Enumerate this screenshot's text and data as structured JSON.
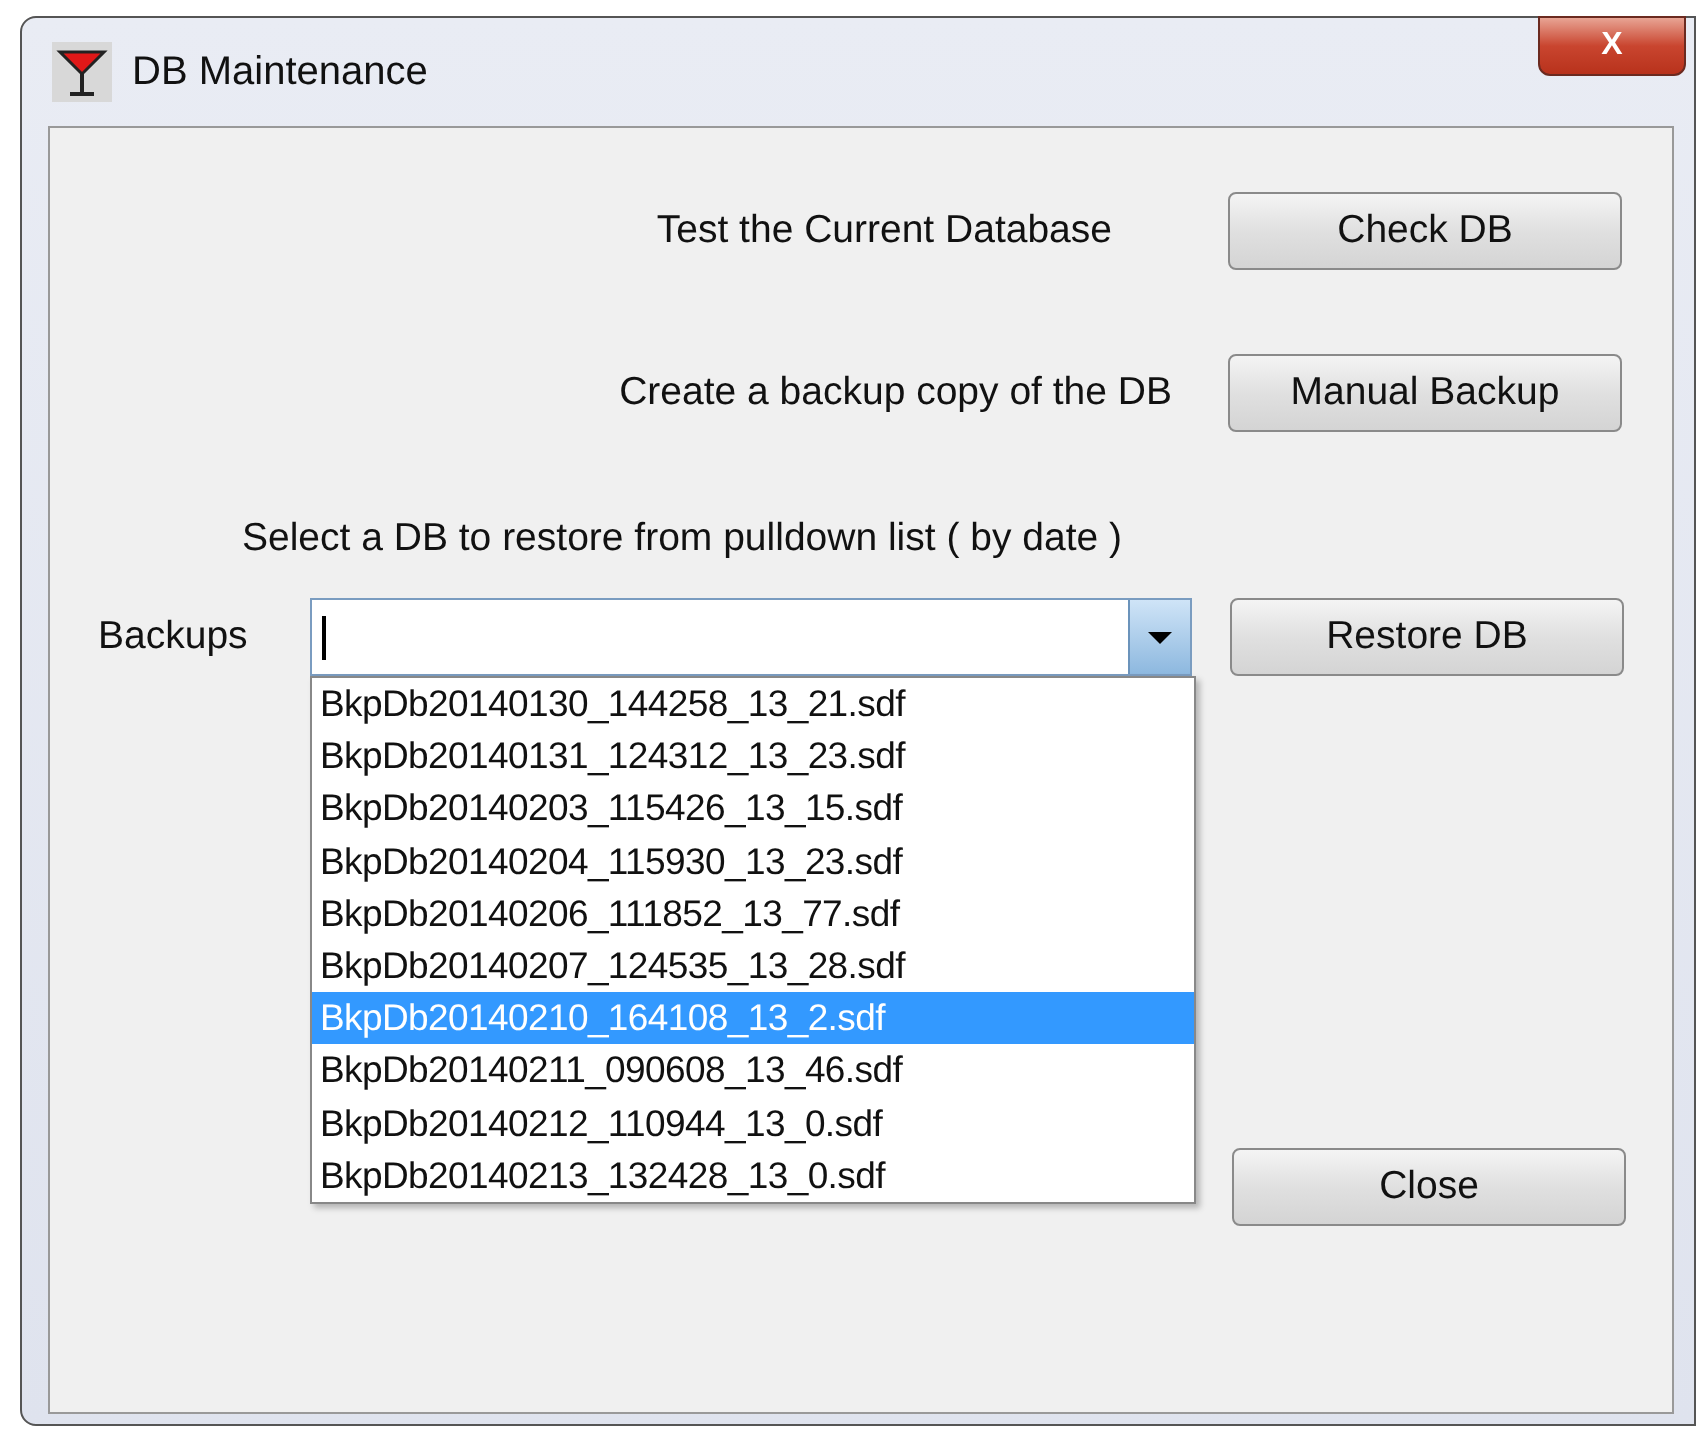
{
  "window": {
    "title": "DB Maintenance",
    "close": "X"
  },
  "actions": [
    {
      "label": "Test the Current Database",
      "button": "Check DB"
    },
    {
      "label": "Create a backup copy of the DB",
      "button": "Manual Backup"
    }
  ],
  "restore": {
    "instruction": "Select a DB to restore from pulldown list ( by date )",
    "field_label": "Backups",
    "button": "Restore DB",
    "expanded": true,
    "options": [
      {
        "text": "BkpDb20140130_144258_13_21.sdf",
        "selected": false
      },
      {
        "text": "BkpDb20140131_124312_13_23.sdf",
        "selected": false
      },
      {
        "text": "BkpDb20140203_115426_13_15.sdf",
        "selected": false
      },
      {
        "text": "BkpDb20140204_115930_13_23.sdf",
        "selected": false
      },
      {
        "text": "BkpDb20140206_111852_13_77.sdf",
        "selected": false
      },
      {
        "text": "BkpDb20140207_124535_13_28.sdf",
        "selected": false
      },
      {
        "text": "BkpDb20140210_164108_13_2.sdf",
        "selected": true
      },
      {
        "text": "BkpDb20140211_090608_13_46.sdf",
        "selected": false
      },
      {
        "text": "BkpDb20140212_110944_13_0.sdf",
        "selected": false
      },
      {
        "text": "BkpDb20140213_132428_13_0.sdf",
        "selected": false
      }
    ]
  },
  "close_button": "Close"
}
